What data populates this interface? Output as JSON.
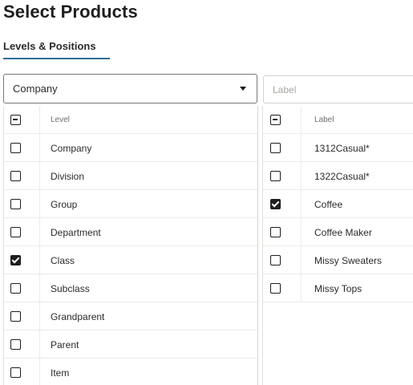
{
  "page": {
    "title": "Select Products"
  },
  "tabs": [
    {
      "label": "Levels & Positions",
      "active": true
    }
  ],
  "level_select": {
    "value": "Company"
  },
  "label_filter": {
    "placeholder": "Label"
  },
  "level_table": {
    "header": {
      "label": "Level",
      "checkbox_state": "indeterminate"
    },
    "rows": [
      {
        "label": "Company",
        "checked": false
      },
      {
        "label": "Division",
        "checked": false
      },
      {
        "label": "Group",
        "checked": false
      },
      {
        "label": "Department",
        "checked": false
      },
      {
        "label": "Class",
        "checked": true
      },
      {
        "label": "Subclass",
        "checked": false
      },
      {
        "label": "Grandparent",
        "checked": false
      },
      {
        "label": "Parent",
        "checked": false
      },
      {
        "label": "Item",
        "checked": false
      }
    ]
  },
  "label_table": {
    "header": {
      "label": "Label",
      "checkbox_state": "indeterminate"
    },
    "rows": [
      {
        "label": "1312Casual*",
        "checked": false
      },
      {
        "label": "1322Casual*",
        "checked": false
      },
      {
        "label": "Coffee",
        "checked": true
      },
      {
        "label": "Coffee Maker",
        "checked": false
      },
      {
        "label": "Missy Sweaters",
        "checked": false
      },
      {
        "label": "Missy Tops",
        "checked": false
      }
    ]
  },
  "colors": {
    "accent": "#2f6f95",
    "text": "#161513",
    "border": "#7a7874"
  },
  "icons": {
    "select_arrow": "caret-down-icon",
    "checkbox": "checkbox-icon"
  }
}
